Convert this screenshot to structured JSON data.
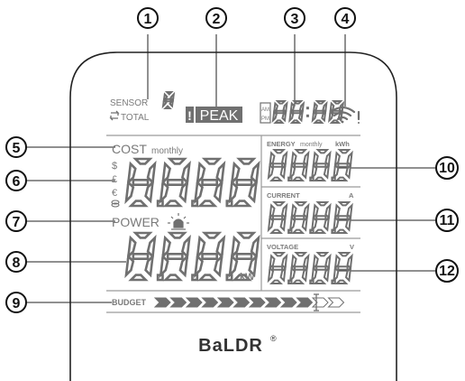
{
  "callouts": [
    {
      "number": "1",
      "target": "sensor-total-indicator"
    },
    {
      "number": "2",
      "target": "peak-indicator"
    },
    {
      "number": "3",
      "target": "clock-display"
    },
    {
      "number": "4",
      "target": "signal-icon"
    },
    {
      "number": "5",
      "target": "cost-monthly-label"
    },
    {
      "number": "6",
      "target": "currency-symbols"
    },
    {
      "number": "7",
      "target": "power-label"
    },
    {
      "number": "8",
      "target": "power-digits"
    },
    {
      "number": "9",
      "target": "budget-bar"
    },
    {
      "number": "10",
      "target": "energy-panel"
    },
    {
      "number": "11",
      "target": "current-panel"
    },
    {
      "number": "12",
      "target": "voltage-panel"
    }
  ],
  "display": {
    "sensor_label": "SENSOR",
    "sensor_digit": "8",
    "total_label": "TOTAL",
    "peak_label": "PEAK",
    "am_label": "AM",
    "pm_label": "PM",
    "clock_digits": "88:88",
    "cost_label": "COST",
    "cost_sub": "monthly",
    "currency_symbols": [
      "$",
      "£",
      "€"
    ],
    "cost_digits": "8.8.8.8",
    "power_label": "POWER",
    "power_digits": "8.8.8.8",
    "power_unit": "kW",
    "energy_label": "ENERGY",
    "energy_sub": "monthly",
    "energy_unit": "kWh",
    "energy_digits": "8.8.8.8",
    "current_label": "CURRENT",
    "current_unit": "A",
    "current_digits": "8.8.8.8",
    "voltage_label": "VOLTAGE",
    "voltage_unit": "V",
    "voltage_digits": "8.8.8.8",
    "budget_label": "BUDGET",
    "budget_arrow_count": 12
  },
  "brand": {
    "name": "BaLDR",
    "mark": "®"
  },
  "colors": {
    "lcd_ink": "#707070",
    "outline": "#222222",
    "callout": "#111111"
  }
}
